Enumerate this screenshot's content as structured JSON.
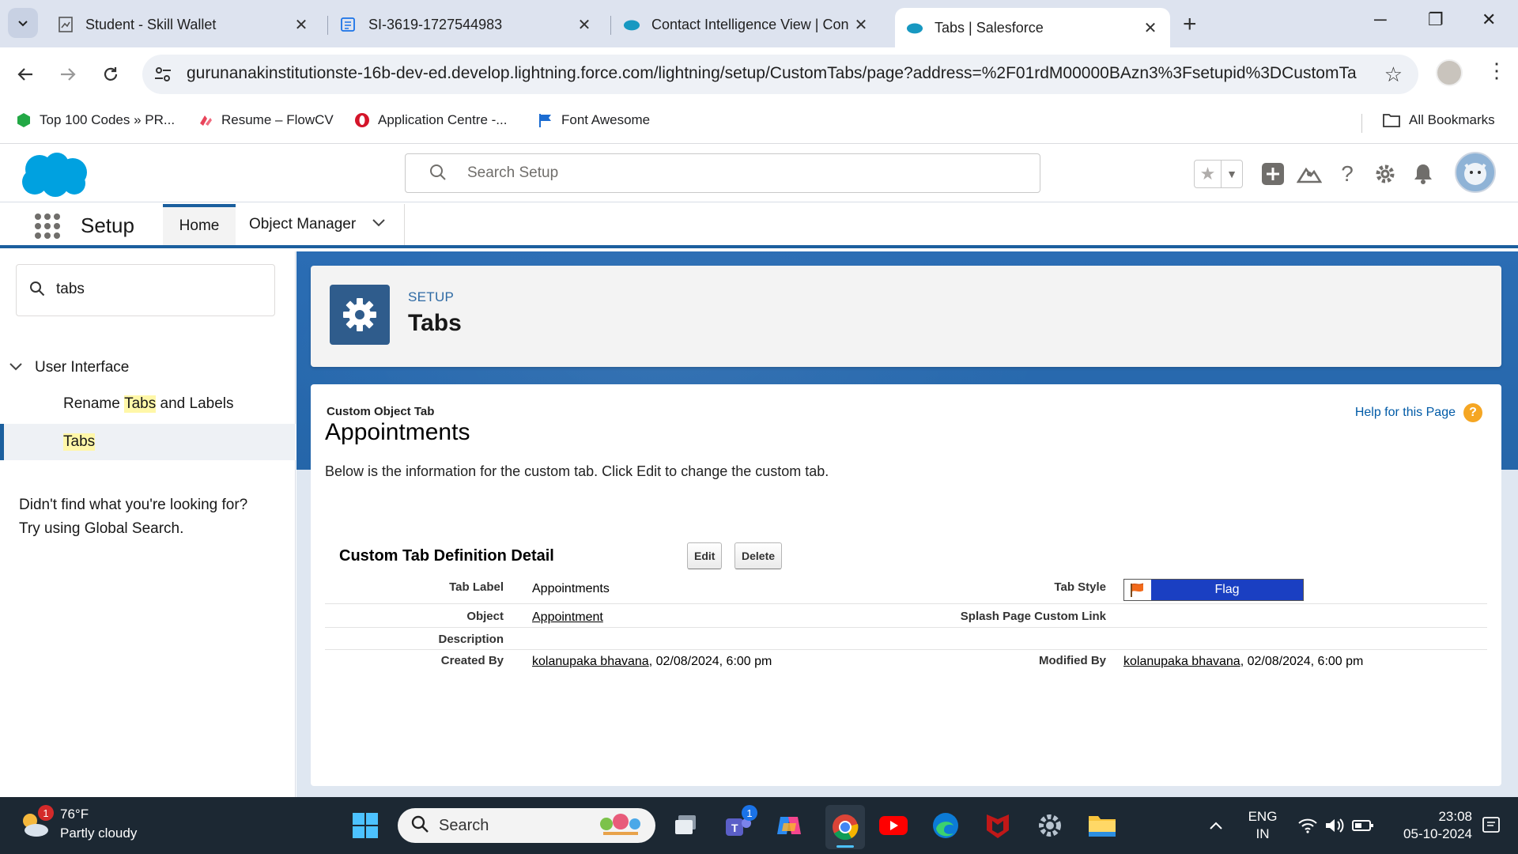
{
  "browser": {
    "tabs": [
      {
        "title": "Student - Skill Wallet",
        "active": false
      },
      {
        "title": "SI-3619-1727544983",
        "active": false
      },
      {
        "title": "Contact Intelligence View | Con",
        "active": false
      },
      {
        "title": "Tabs | Salesforce",
        "active": true
      }
    ],
    "url": "gurunanakinstitutionste-16b-dev-ed.develop.lightning.force.com/lightning/setup/CustomTabs/page?address=%2F01rdM00000BAzn3%3Fsetupid%3DCustomTa...",
    "bookmarks": [
      {
        "label": "Top 100 Codes » PR..."
      },
      {
        "label": "Resume – FlowCV"
      },
      {
        "label": "Application Centre -..."
      },
      {
        "label": "Font Awesome"
      }
    ],
    "all_bookmarks": "All Bookmarks"
  },
  "sf": {
    "search_placeholder": "Search Setup",
    "app_title": "Setup",
    "nav_home": "Home",
    "nav_object_manager": "Object Manager"
  },
  "sidebar": {
    "quick_find_value": "tabs",
    "group": "User Interface",
    "items": [
      {
        "pre": "Rename ",
        "hl": "Tabs",
        "post": " and Labels"
      },
      {
        "pre": "",
        "hl": "Tabs",
        "post": ""
      }
    ],
    "help_line1": "Didn't find what you're looking for?",
    "help_line2": "Try using Global Search."
  },
  "page": {
    "eyebrow": "SETUP",
    "title": "Tabs",
    "object_type": "Custom Object Tab",
    "object_name": "Appointments",
    "help_link": "Help for this Page",
    "description": "Below is the information for the custom tab. Click Edit to change the custom tab.",
    "section_title": "Custom Tab Definition Detail",
    "edit_label": "Edit",
    "delete_label": "Delete",
    "fields": {
      "tab_label_lbl": "Tab Label",
      "tab_label_val": "Appointments",
      "tab_style_lbl": "Tab Style",
      "tab_style_val": "Flag",
      "object_lbl": "Object",
      "object_val": "Appointment",
      "splash_lbl": "Splash Page Custom Link",
      "description_lbl": "Description",
      "created_by_lbl": "Created By",
      "created_by_user": "kolanupaka bhavana",
      "created_by_date": ", 02/08/2024, 6:00 pm",
      "modified_by_lbl": "Modified By",
      "modified_by_user": "kolanupaka bhavana",
      "modified_by_date": ", 02/08/2024, 6:00 pm"
    }
  },
  "taskbar": {
    "weather_temp": "76°F",
    "weather_desc": "Partly cloudy",
    "weather_badge": "1",
    "search_label": "Search",
    "teams_badge": "1",
    "lang1": "ENG",
    "lang2": "IN",
    "time": "23:08",
    "date": "05-10-2024"
  },
  "colors": {
    "salesforce_blue": "#1b5f9e",
    "flag_bar": "#1a3fc2",
    "help_icon": "#f5a623"
  }
}
